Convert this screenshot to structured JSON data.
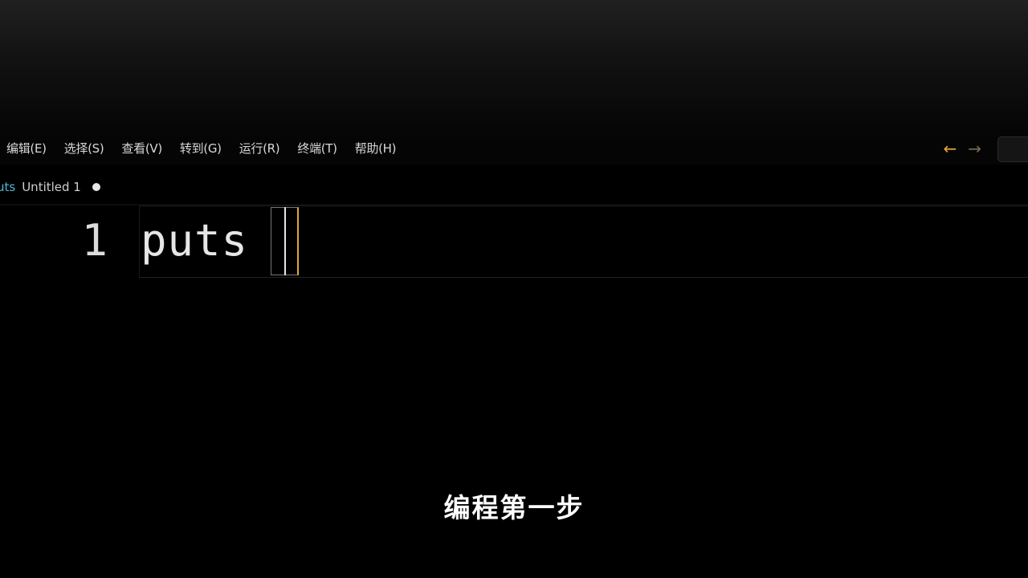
{
  "menubar": {
    "items": [
      {
        "label": "编辑(E)"
      },
      {
        "label": "选择(S)"
      },
      {
        "label": "查看(V)"
      },
      {
        "label": "转到(G)"
      },
      {
        "label": "运行(R)"
      },
      {
        "label": "终端(T)"
      },
      {
        "label": "帮助(H)"
      }
    ],
    "back_icon": "←",
    "forward_icon": "→"
  },
  "tab": {
    "lang_label": "uts",
    "title": "Untitled 1",
    "dirty_indicator": "dot-icon"
  },
  "editor": {
    "lines": [
      {
        "number": "1",
        "text": "puts "
      }
    ]
  },
  "subtitle": "编程第一步",
  "colors": {
    "accent": "#e0a83c",
    "tab_lang": "#4fb8d8",
    "background": "#000000"
  }
}
